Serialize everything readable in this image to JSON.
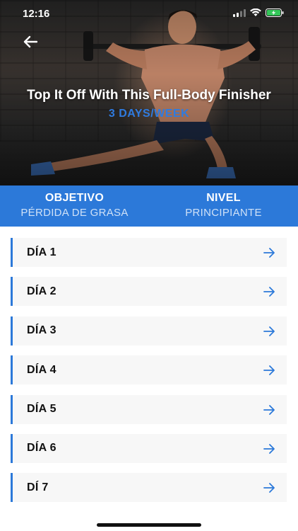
{
  "status_bar": {
    "time": "12:16"
  },
  "hero": {
    "title": "Top It Off With This Full-Body Finisher",
    "subtitle": "3 DAYS/WEEK"
  },
  "info": {
    "objective_label": "OBJETIVO",
    "objective_value": "PÉRDIDA DE GRASA",
    "level_label": "NIVEL",
    "level_value": "PRINCIPIANTE"
  },
  "days": [
    {
      "label": "DÍA 1"
    },
    {
      "label": "DÍA 2"
    },
    {
      "label": "DÍA 3"
    },
    {
      "label": "DÍA 4"
    },
    {
      "label": "DÍA 5"
    },
    {
      "label": "DÍA 6"
    },
    {
      "label": "DÍ 7"
    }
  ],
  "colors": {
    "accent": "#2c79d9",
    "subtitle": "#2f7be0",
    "battery": "#34c759"
  },
  "icons": {
    "back": "arrow-left-icon",
    "row_arrow": "arrow-right-icon",
    "signal": "signal-icon",
    "wifi": "wifi-icon",
    "battery": "battery-charging-icon"
  }
}
